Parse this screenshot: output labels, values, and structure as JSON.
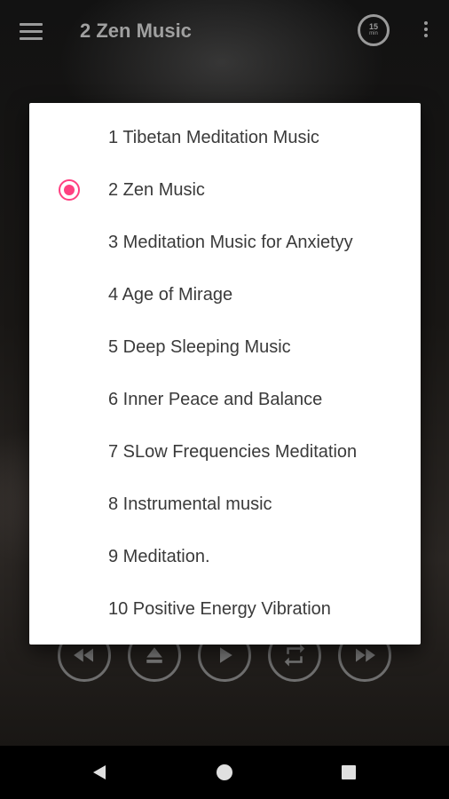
{
  "app_bar": {
    "title": "2 Zen Music",
    "menu_icon": "hamburger-menu-icon",
    "timer": {
      "value": "15",
      "unit": "min",
      "icon": "sleep-timer-icon"
    },
    "overflow_icon": "more-vert-icon"
  },
  "player_controls": [
    "rewind-icon",
    "eject-icon",
    "play-icon",
    "repeat-icon",
    "fast-forward-icon"
  ],
  "dialog": {
    "selected_index": 1,
    "accent_color": "#ff4081",
    "options": [
      {
        "label": "1 Tibetan Meditation Music",
        "selected": false
      },
      {
        "label": "2 Zen Music",
        "selected": true
      },
      {
        "label": "3 Meditation Music for Anxietyy",
        "selected": false
      },
      {
        "label": "4 Age of Mirage",
        "selected": false
      },
      {
        "label": "5 Deep Sleeping Music",
        "selected": false
      },
      {
        "label": "6 Inner Peace and Balance",
        "selected": false
      },
      {
        "label": "7 SLow Frequencies Meditation",
        "selected": false
      },
      {
        "label": "8 Instrumental music",
        "selected": false
      },
      {
        "label": "9 Meditation.",
        "selected": false
      },
      {
        "label": "10 Positive Energy Vibration",
        "selected": false
      }
    ]
  },
  "nav_bar": {
    "icons": [
      "back-icon",
      "home-icon",
      "recents-icon"
    ]
  }
}
